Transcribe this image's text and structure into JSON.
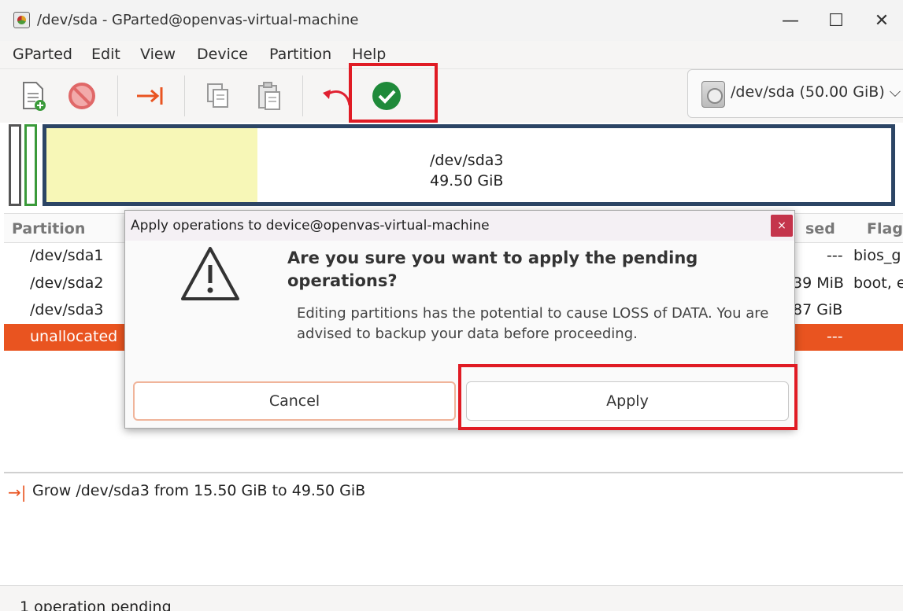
{
  "window": {
    "title": "/dev/sda - GParted@openvas-virtual-machine",
    "minimize": "—",
    "maximize": "☐",
    "close": "✕"
  },
  "menu": [
    "GParted",
    "Edit",
    "View",
    "Device",
    "Partition",
    "Help"
  ],
  "toolbar": {
    "items": [
      "new-partition-icon",
      "delete-icon",
      "resize-move-icon",
      "copy-icon",
      "paste-icon",
      "undo-icon",
      "apply-icon"
    ],
    "device_selector": "/dev/sda (50.00 GiB)",
    "dropdown_glyph": "⌵"
  },
  "disk_map": {
    "partition_name": "/dev/sda3",
    "partition_size": "49.50 GiB",
    "used_fraction": 0.25
  },
  "table": {
    "headers": [
      "Partition",
      "Used",
      "Flag"
    ],
    "header_visible_fragments": [
      "Partition",
      "sed",
      "Flag"
    ],
    "rows": [
      {
        "partition": "/dev/sda1",
        "used": "---",
        "flags": "bios_g"
      },
      {
        "partition": "/dev/sda2",
        "used": "39 MiB",
        "flags": "boot, e"
      },
      {
        "partition": "/dev/sda3",
        "used": "87 GiB",
        "flags": ""
      },
      {
        "partition": "unallocated",
        "used": "---",
        "flags": ""
      }
    ]
  },
  "operations": {
    "items": [
      "Grow /dev/sda3 from 15.50 GiB to 49.50 GiB"
    ]
  },
  "status": "1 operation pending",
  "dialog": {
    "title": "Apply operations to device@openvas-virtual-machine",
    "heading": "Are you sure you want to apply the pending operations?",
    "body": "Editing partitions has the potential to cause LOSS of DATA. You are advised to backup your data before proceeding.",
    "cancel_label": "Cancel",
    "apply_label": "Apply",
    "close_glyph": "×"
  },
  "colors": {
    "accent": "#e95420",
    "highlight": "#e01b24",
    "partition_border": "#2c4565",
    "used_space": "#f7f7b7"
  }
}
